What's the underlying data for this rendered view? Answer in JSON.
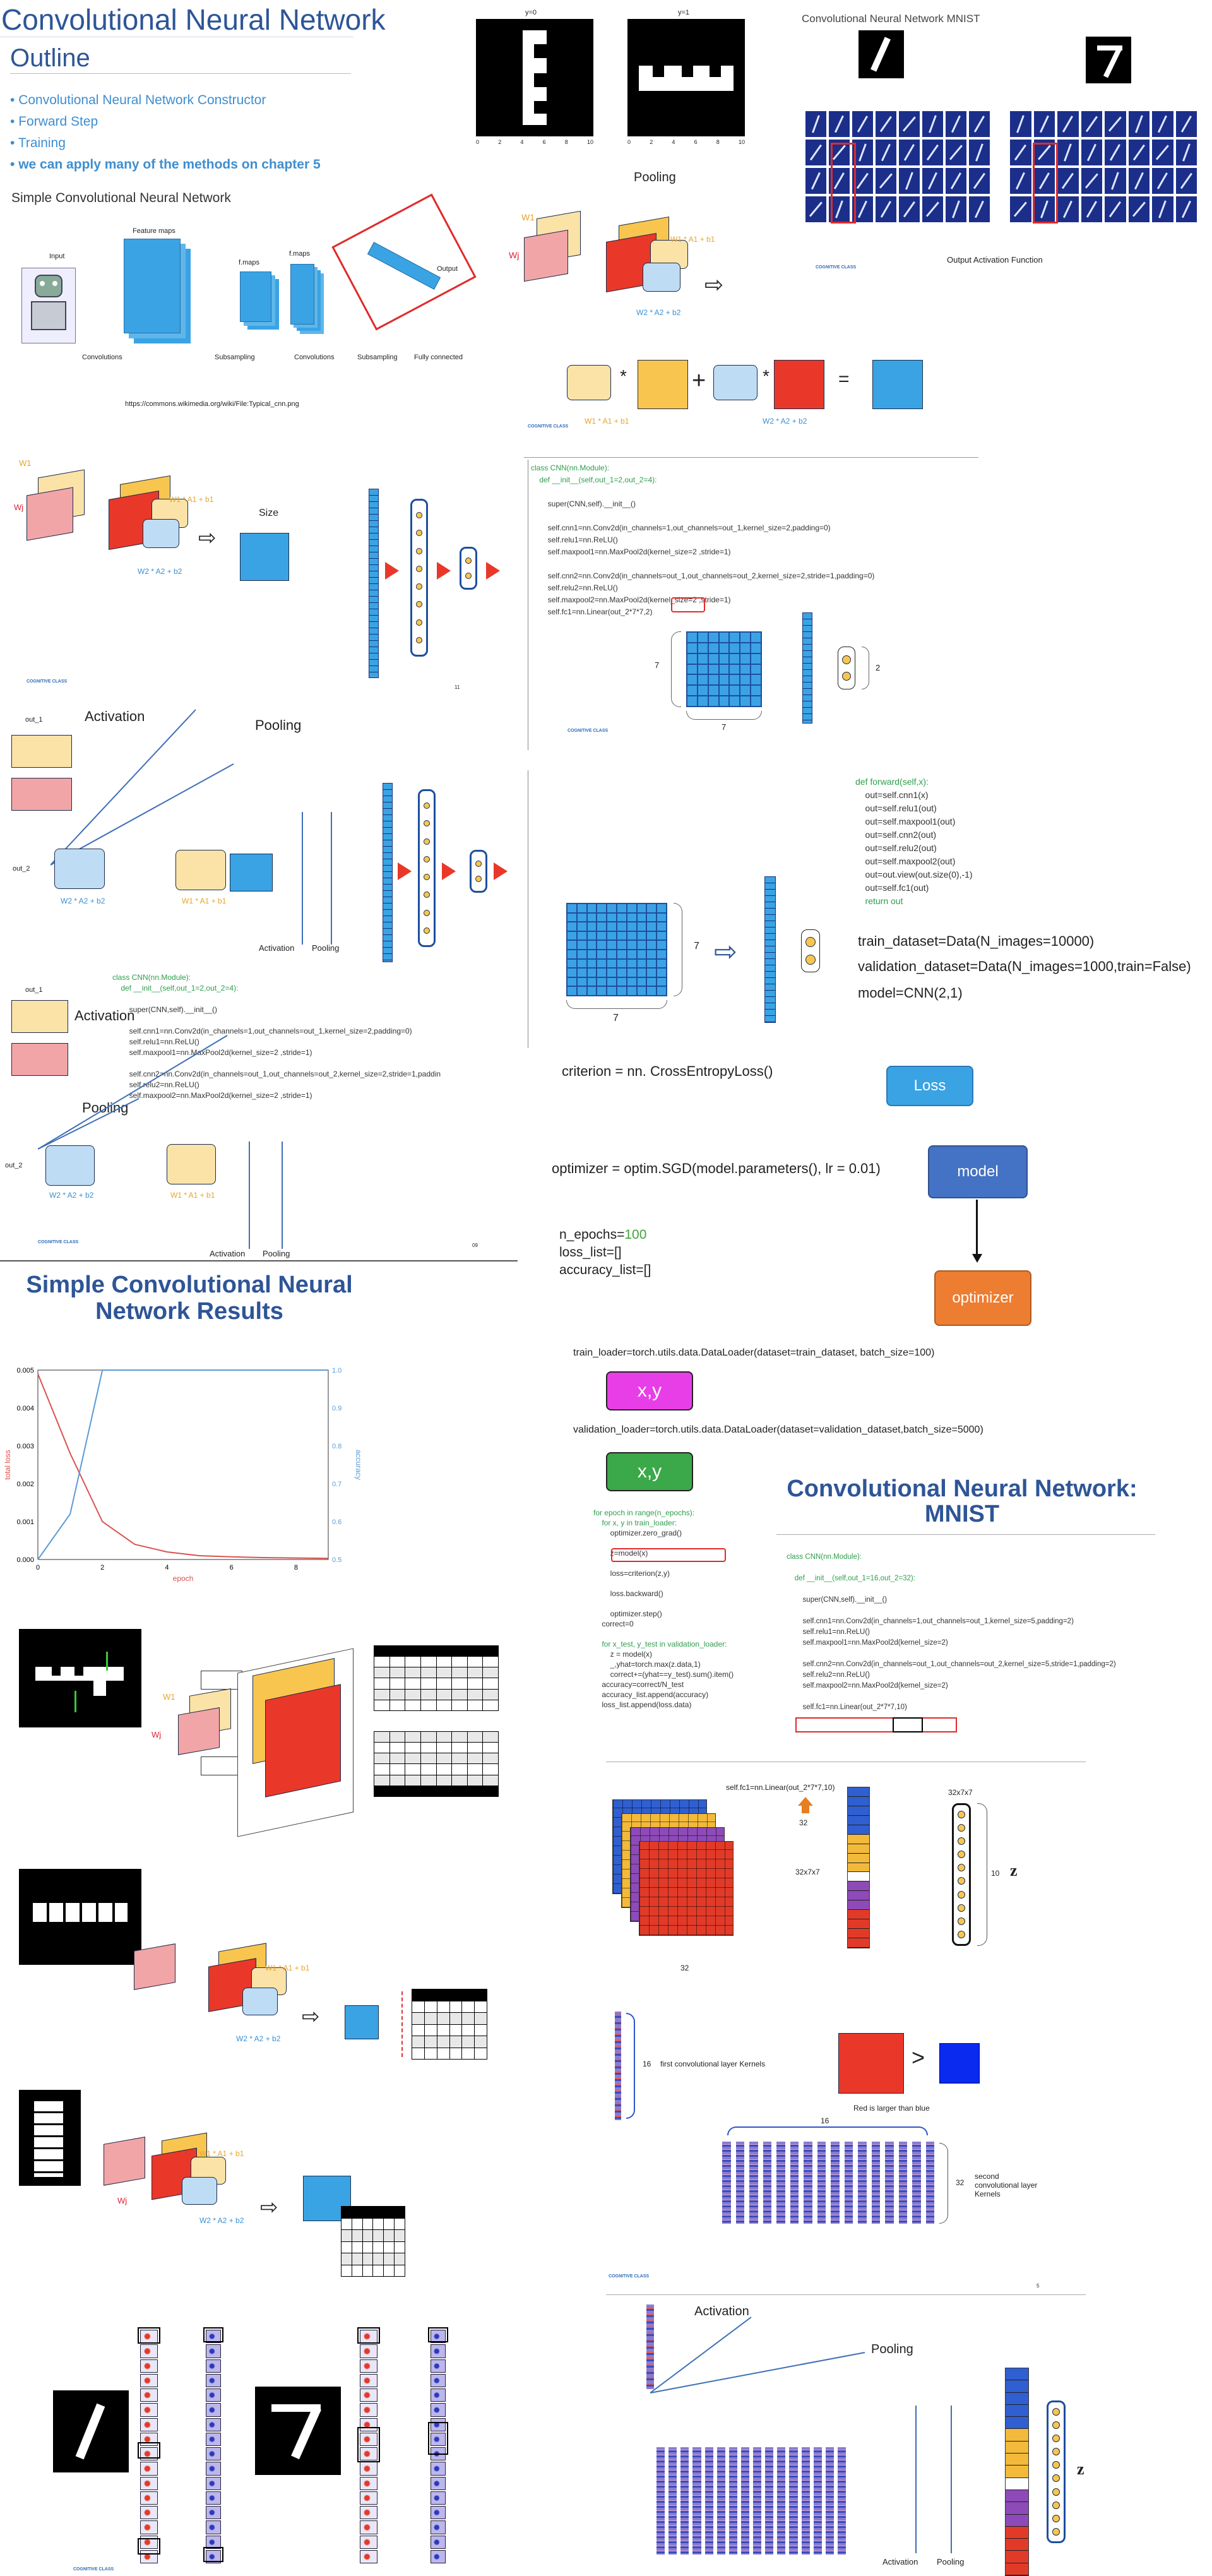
{
  "slide1": {
    "title": "Convolutional Neural Network",
    "outline": "Outline",
    "bullets": [
      "Convolutional Neural Network Constructor",
      "Forward Step",
      "Training",
      "we can apply many of the methods on chapter 5"
    ],
    "subtitle": "Simple Convolutional Neural Network",
    "diagram_labels": {
      "input": "Input",
      "feature_maps": "Feature maps",
      "fmaps1": "f.maps",
      "fmaps2": "f.maps",
      "output": "Output",
      "convolutions1": "Convolutions",
      "subsampling1": "Subsampling",
      "convolutions2": "Convolutions",
      "subsampling2": "Subsampling",
      "fully_connected": "Fully connected"
    },
    "url": "https://commons.wikimedia.org/wiki/File:Typical_cnn.png"
  },
  "top_images": {
    "y0": "y=0",
    "y1": "y=1",
    "xticks": [
      "0",
      "2",
      "4",
      "6",
      "8",
      "10"
    ],
    "yticks": [
      "0",
      "2",
      "4",
      "6",
      "8",
      "10"
    ],
    "pooling": "Pooling"
  },
  "mnist_top": {
    "title": "Convolutional Neural Network MNIST",
    "output_activation": "Output Activation Function"
  },
  "eq": {
    "w1": "W1",
    "wj": "Wj",
    "b1": "b1",
    "star": "*",
    "plus": "+",
    "eq": "=",
    "lbl1": "W1 * A1 + b1",
    "lbl2": "W2 * A2 + b2"
  },
  "slide2": {
    "size_label": "Size",
    "page_num": "11"
  },
  "code1": {
    "lines": [
      "class CNN(nn.Module):",
      "    def __init__(self,out_1=2,out_2=4):",
      "",
      "        super(CNN,self).__init__()",
      "",
      "        self.cnn1=nn.Conv2d(in_channels=1,out_channels=out_1,kernel_size=2,padding=0)",
      "        self.relu1=nn.ReLU()",
      "        self.maxpool1=nn.MaxPool2d(kernel_size=2 ,stride=1)",
      "",
      "        self.cnn2=nn.Conv2d(in_channels=out_1,out_channels=out_2,kernel_size=2,stride=1,padding=0)",
      "        self.relu2=nn.ReLU()",
      "        self.maxpool2=nn.MaxPool2d(kernel_size=2 ,stride=1)",
      "        self.fc1=nn.Linear(out_2*7*7,2)"
    ],
    "seven_a": "7",
    "seven_b": "7",
    "two": "2"
  },
  "slide3": {
    "activation": "Activation",
    "pooling": "Pooling",
    "out1": "out_1",
    "out2": "out_2",
    "activation_b": "Activation",
    "pooling_b": "Pooling"
  },
  "forward": {
    "lines": [
      "def forward(self,x):",
      "    out=self.cnn1(x)",
      "    out=self.relu1(out)",
      "    out=self.maxpool1(out)",
      "    out=self.cnn2(out)",
      "    out=self.relu2(out)",
      "    out=self.maxpool2(out)",
      "    out=out.view(out.size(0),-1)",
      "    out=self.fc1(out)",
      "    return out"
    ],
    "seven_a": "7",
    "seven_b": "7"
  },
  "data_setup": {
    "train": "train_dataset=Data(N_images=10000)",
    "valid": "validation_dataset=Data(N_images=1000,train=False)",
    "model": "model=CNN(2,1)"
  },
  "slide4": {
    "out1": "out_1",
    "activation": "Activation",
    "pooling": "Pooling",
    "out2": "out_2",
    "activation_b": "Activation",
    "pooling_b": "Pooling",
    "page_num": "09",
    "code": [
      "class CNN(nn.Module):",
      "    def __init__(self,out_1=2,out_2=4):",
      "",
      "        super(CNN,self).__init__()",
      "",
      "        self.cnn1=nn.Conv2d(in_channels=1,out_channels=out_1,kernel_size=2,padding=0)",
      "        self.relu1=nn.ReLU()",
      "        self.maxpool1=nn.MaxPool2d(kernel_size=2 ,stride=1)",
      "",
      "        self.cnn2=nn.Conv2d(in_channels=out_1,out_channels=out_2,kernel_size=2,stride=1,paddin",
      "        self.relu2=nn.ReLU()",
      "        self.maxpool2=nn.MaxPool2d(kernel_size=2 ,stride=1)"
    ]
  },
  "training": {
    "criterion": "criterion = nn. CrossEntropyLoss()",
    "loss": "Loss",
    "optimizer_code": "optimizer = optim.SGD(model.parameters(), lr = 0.01)",
    "model": "model",
    "optimizer": "optimizer",
    "n_epochs": "n_epochs=100",
    "loss_list": "loss_list=[]",
    "accuracy_list": "accuracy_list=[]",
    "train_loader": "train_loader=torch.utils.data.DataLoader(dataset=train_dataset, batch_size=100)",
    "xy1": "x,y",
    "valid_loader": "validation_loader=torch.utils.data.DataLoader(dataset=validation_dataset,batch_size=5000)",
    "xy2": "x,y",
    "loop": [
      "for epoch in range(n_epochs):",
      "    for x, y in train_loader:",
      "        optimizer.zero_grad()",
      "",
      "        z=model(x)",
      "",
      "        loss=criterion(z,y)",
      "",
      "        loss.backward()",
      "",
      "        optimizer.step()",
      "    correct=0",
      "",
      "    for x_test, y_test in validation_loader:",
      "        z = model(x)",
      "        _,yhat=torch.max(z.data,1)",
      "        correct+=(yhat==y_test).sum().item()",
      "    accuracy=correct/N_test",
      "    accuracy_list.append(accuracy)",
      "    loss_list.append(loss.data)"
    ]
  },
  "results": {
    "title1": "Simple Convolutional Neural",
    "title2": "Network Results"
  },
  "chart_data": {
    "type": "line",
    "x": [
      0,
      1,
      2,
      3,
      4,
      5,
      6,
      7,
      8,
      9
    ],
    "series": [
      {
        "name": "total loss",
        "values": [
          0.0049,
          0.0028,
          0.001,
          0.0004,
          0.0002,
          0.0001,
          7e-05,
          5e-05,
          4e-05,
          3e-05
        ]
      },
      {
        "name": "accuracy",
        "values": [
          0.5,
          0.62,
          1.0,
          1.0,
          1.0,
          1.0,
          1.0,
          1.0,
          1.0,
          1.0
        ]
      }
    ],
    "xlabel": "epoch",
    "ylabel": "total loss",
    "y2label": "accuracy",
    "ylim": [
      0,
      0.005
    ],
    "y2lim": [
      0.5,
      1.0
    ],
    "xticks": [
      "0",
      "2",
      "4",
      "6",
      "8"
    ],
    "yticks": [
      "0.000",
      "0.001",
      "0.002",
      "0.003",
      "0.004",
      "0.005"
    ],
    "y2ticks": [
      "0.5",
      "0.6",
      "0.7",
      "0.8",
      "0.9",
      "1.0"
    ],
    "colors": [
      "#d9534f",
      "#5b9bd5"
    ]
  },
  "mnist": {
    "title1": "Convolutional Neural Network:",
    "title2": "MNIST",
    "code": [
      "class CNN(nn.Module):",
      "",
      "    def __init__(self,out_1=16,out_2=32):",
      "",
      "        super(CNN,self).__init__()",
      "",
      "        self.cnn1=nn.Conv2d(in_channels=1,out_channels=out_1,kernel_size=5,padding=2)",
      "        self.relu1=nn.ReLU()",
      "        self.maxpool1=nn.MaxPool2d(kernel_size=2)",
      "",
      "        self.cnn2=nn.Conv2d(in_channels=out_1,out_channels=out_2,kernel_size=5,stride=1,padding=2)",
      "        self.relu2=nn.ReLU()",
      "        self.maxpool2=nn.MaxPool2d(kernel_size=2)",
      "",
      "        self.fc1=nn.Linear(out_2*7*7,10)"
    ],
    "fc_label": "self.fc1=nn.Linear(out_2*7*7,10)",
    "n32": "32",
    "n32b": "32",
    "dims1": "32x7x7",
    "dims2": "32x7x7",
    "ten": "10",
    "z": "z",
    "n16": "16",
    "first_kernels": "first convolutional layer Kernels",
    "red_larger": "Red is larger than blue",
    "gt": ">",
    "n16b": "16",
    "n32c": "32",
    "second_kernels": "second convolutional layer Kernels",
    "page_num": "5",
    "activation": "Activation",
    "pooling": "Pooling",
    "activation_b": "Activation",
    "pooling_b": "Pooling",
    "z2": "z"
  },
  "logo": {
    "text": "COGNITIVE CLASS"
  }
}
